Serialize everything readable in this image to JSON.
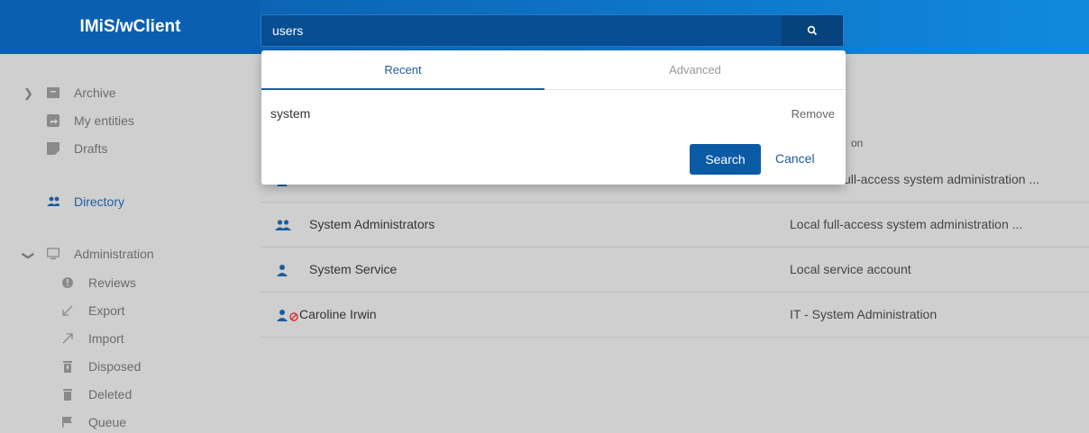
{
  "app": {
    "title": "IMiS/wClient"
  },
  "search": {
    "value": "users",
    "button_icon": "search-icon"
  },
  "sidebar": {
    "items": [
      {
        "label": "Archive",
        "icon": "archive-icon"
      },
      {
        "label": "My entities",
        "icon": "share-icon"
      },
      {
        "label": "Drafts",
        "icon": "draft-icon"
      },
      {
        "label": "Directory",
        "icon": "people-icon"
      },
      {
        "label": "Administration",
        "icon": "monitor-icon"
      },
      {
        "label": "Reviews",
        "icon": "info-icon"
      },
      {
        "label": "Export",
        "icon": "arrow-down-left-icon"
      },
      {
        "label": "Import",
        "icon": "arrow-up-right-icon"
      },
      {
        "label": "Disposed",
        "icon": "trash-icon"
      },
      {
        "label": "Deleted",
        "icon": "delete-icon"
      },
      {
        "label": "Queue",
        "icon": "flag-icon"
      }
    ]
  },
  "dropdown": {
    "tabs": [
      {
        "label": "Recent"
      },
      {
        "label": "Advanced"
      }
    ],
    "recent": [
      {
        "term": "system",
        "remove_label": "Remove"
      }
    ],
    "search_label": "Search",
    "cancel_label": "Cancel"
  },
  "table": {
    "header_fragment": "on",
    "rows": [
      {
        "name": "",
        "desc": "ull-access system administration ...",
        "icon": "user-icon"
      },
      {
        "name": "System Administrators",
        "desc": "Local full-access system administration ...",
        "icon": "group-icon"
      },
      {
        "name": "System Service",
        "desc": "Local service account",
        "icon": "user-icon"
      },
      {
        "name": "Caroline Irwin",
        "desc": "IT - System Administration",
        "icon": "disabled-user-icon"
      }
    ]
  },
  "colors": {
    "brand": "#0b5fb0",
    "accent": "#1c5d9e",
    "disabled": "#d32f2f"
  }
}
